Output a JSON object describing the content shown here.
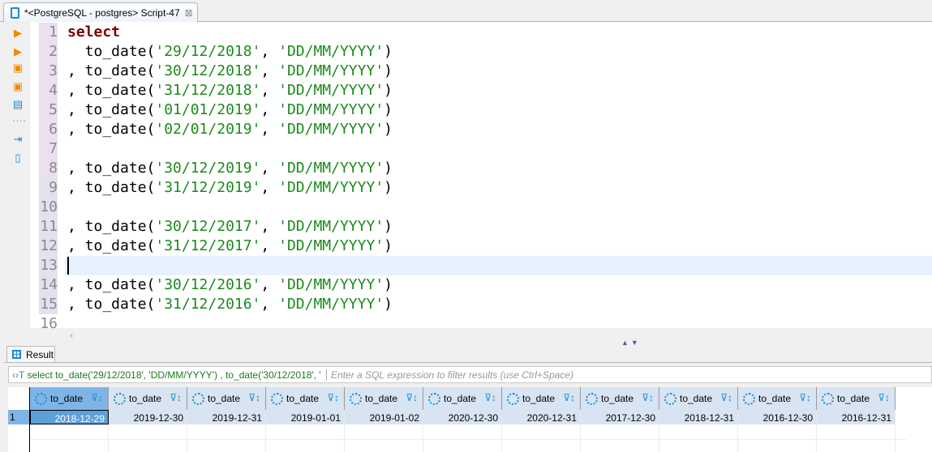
{
  "tab": {
    "title": "*<PostgreSQL - postgres> Script-47",
    "close": "⊠"
  },
  "toolbar": [
    "execute-statement",
    "execute-statement-new-tab",
    "execute-script",
    "execute-script-new-tab",
    "explain-plan",
    "load-script",
    "export-script"
  ],
  "editor": {
    "lines": [
      {
        "n": "1",
        "parts": [
          [
            "kw",
            "select"
          ]
        ]
      },
      {
        "n": "2",
        "parts": [
          [
            "",
            "  to_date("
          ],
          [
            "str",
            "'29/12/2018'"
          ],
          [
            "",
            ", "
          ],
          [
            "str",
            "'DD/MM/YYYY'"
          ],
          [
            "",
            ")"
          ]
        ]
      },
      {
        "n": "3",
        "parts": [
          [
            "",
            ", to_date("
          ],
          [
            "str",
            "'30/12/2018'"
          ],
          [
            "",
            ", "
          ],
          [
            "str",
            "'DD/MM/YYYY'"
          ],
          [
            "",
            ")"
          ]
        ]
      },
      {
        "n": "4",
        "parts": [
          [
            "",
            ", to_date("
          ],
          [
            "str",
            "'31/12/2018'"
          ],
          [
            "",
            ", "
          ],
          [
            "str",
            "'DD/MM/YYYY'"
          ],
          [
            "",
            ")"
          ]
        ]
      },
      {
        "n": "5",
        "parts": [
          [
            "",
            ", to_date("
          ],
          [
            "str",
            "'01/01/2019'"
          ],
          [
            "",
            ", "
          ],
          [
            "str",
            "'DD/MM/YYYY'"
          ],
          [
            "",
            ")"
          ]
        ]
      },
      {
        "n": "6",
        "parts": [
          [
            "",
            ", to_date("
          ],
          [
            "str",
            "'02/01/2019'"
          ],
          [
            "",
            ", "
          ],
          [
            "str",
            "'DD/MM/YYYY'"
          ],
          [
            "",
            ")"
          ]
        ]
      },
      {
        "n": "7",
        "parts": []
      },
      {
        "n": "8",
        "parts": [
          [
            "",
            ", to_date("
          ],
          [
            "str",
            "'30/12/2019'"
          ],
          [
            "",
            ", "
          ],
          [
            "str",
            "'DD/MM/YYYY'"
          ],
          [
            "",
            ")"
          ]
        ]
      },
      {
        "n": "9",
        "parts": [
          [
            "",
            ", to_date("
          ],
          [
            "str",
            "'31/12/2019'"
          ],
          [
            "",
            ", "
          ],
          [
            "str",
            "'DD/MM/YYYY'"
          ],
          [
            "",
            ")"
          ]
        ]
      },
      {
        "n": "10",
        "parts": []
      },
      {
        "n": "11",
        "parts": [
          [
            "",
            ", to_date("
          ],
          [
            "str",
            "'30/12/2017'"
          ],
          [
            "",
            ", "
          ],
          [
            "str",
            "'DD/MM/YYYY'"
          ],
          [
            "",
            ")"
          ]
        ]
      },
      {
        "n": "12",
        "parts": [
          [
            "",
            ", to_date("
          ],
          [
            "str",
            "'31/12/2017'"
          ],
          [
            "",
            ", "
          ],
          [
            "str",
            "'DD/MM/YYYY'"
          ],
          [
            "",
            ")"
          ]
        ]
      },
      {
        "n": "13",
        "parts": []
      },
      {
        "n": "14",
        "parts": [
          [
            "",
            ", to_date("
          ],
          [
            "str",
            "'30/12/2016'"
          ],
          [
            "",
            ", "
          ],
          [
            "str",
            "'DD/MM/YYYY'"
          ],
          [
            "",
            ")"
          ]
        ]
      },
      {
        "n": "15",
        "parts": [
          [
            "",
            ", to_date("
          ],
          [
            "str",
            "'31/12/2016'"
          ],
          [
            "",
            ", "
          ],
          [
            "str",
            "'DD/MM/YYYY'"
          ],
          [
            "",
            ")"
          ]
        ]
      },
      {
        "n": "16",
        "parts": []
      }
    ]
  },
  "result": {
    "tab_label": "Result",
    "query": "select to_date('29/12/2018', 'DD/MM/YYYY') , to_date('30/12/2018', '",
    "filter_placeholder": "Enter a SQL expression to filter results (use Ctrl+Space)",
    "columns": [
      "to_date",
      "to_date",
      "to_date",
      "to_date",
      "to_date",
      "to_date",
      "to_date",
      "to_date",
      "to_date",
      "to_date",
      "to_date"
    ],
    "rows": [
      {
        "num": "1",
        "values": [
          "2018-12-29",
          "2019-12-30",
          "2019-12-31",
          "2019-01-01",
          "2019-01-02",
          "2020-12-30",
          "2020-12-31",
          "2017-12-30",
          "2018-12-31",
          "2016-12-30",
          "2016-12-31"
        ]
      }
    ]
  }
}
